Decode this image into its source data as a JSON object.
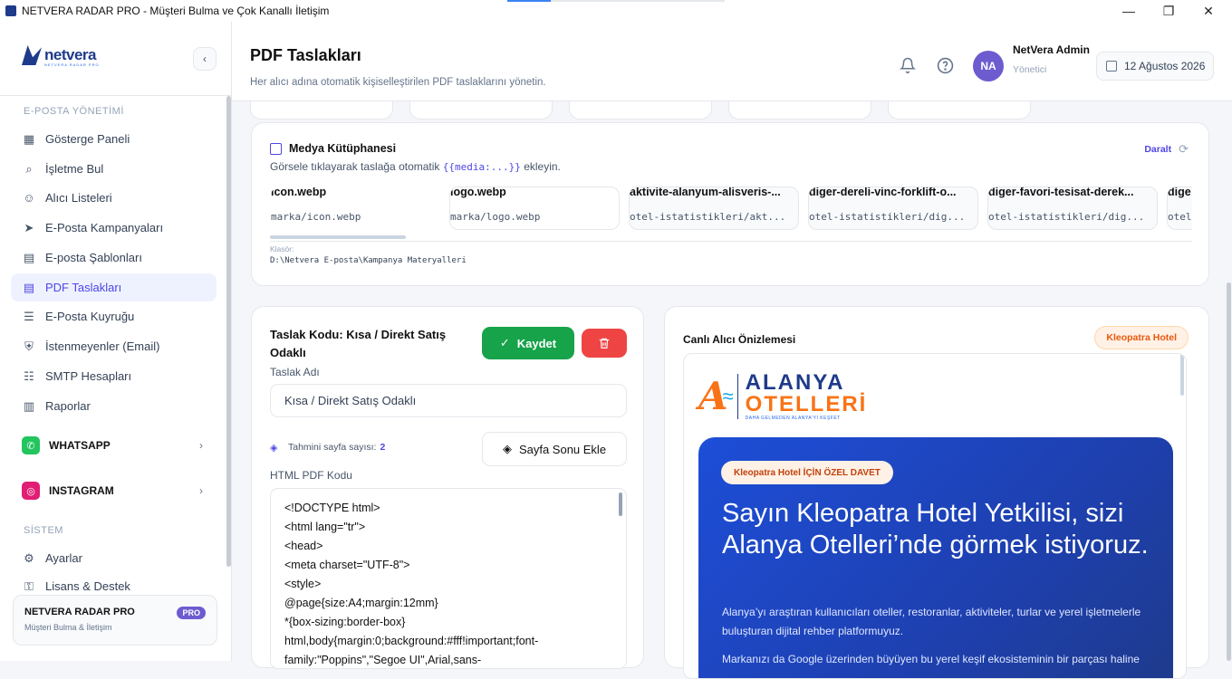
{
  "window": {
    "title": "NETVERA RADAR PRO - Müşteri Bulma ve Çok Kanallı İletişim",
    "minimize": "—",
    "maximize": "❐",
    "close": "✕"
  },
  "sidebar": {
    "section_email": "E-POSTA YÖNETİMİ",
    "items": [
      {
        "label": "Gösterge Paneli",
        "icon": "dashboard-icon"
      },
      {
        "label": "İşletme Bul",
        "icon": "search-icon"
      },
      {
        "label": "Alıcı Listeleri",
        "icon": "users-icon"
      },
      {
        "label": "E-Posta Kampanyaları",
        "icon": "send-icon"
      },
      {
        "label": "E-posta Şablonları",
        "icon": "file-icon"
      },
      {
        "label": "PDF Taslakları",
        "icon": "file-icon",
        "active": true
      },
      {
        "label": "E-Posta Kuyruğu",
        "icon": "list-icon"
      },
      {
        "label": "İstenmeyenler (Email)",
        "icon": "shield-icon"
      },
      {
        "label": "SMTP Hesapları",
        "icon": "server-icon"
      },
      {
        "label": "Raporlar",
        "icon": "chart-icon"
      }
    ],
    "whatsapp": "WHATSAPP",
    "instagram": "INSTAGRAM",
    "section_system": "SİSTEM",
    "settings": "Ayarlar",
    "license": "Lisans & Destek",
    "pro_title": "NETVERA RADAR PRO",
    "pro_sub": "Müşteri Bulma & İletişim",
    "pro_badge": "PRO"
  },
  "header": {
    "title": "PDF Taslakları",
    "subtitle": "Her alıcı adına otomatik kişiselleştirilen PDF taslaklarını yönetin.",
    "user_name": "NetVera Admin",
    "user_role": "Yönetici",
    "avatar": "NA",
    "date": "12 Ağustos 2026"
  },
  "media": {
    "title": "Medya Kütüphanesi",
    "desc_before": "Görsele tıklayarak taslağa otomatik ",
    "token": "{{media:...}}",
    "desc_after": " ekleyin.",
    "collapse": "Daralt",
    "tiles": [
      {
        "name": "icon.webp",
        "path": "marka/icon.webp"
      },
      {
        "name": "logo.webp",
        "path": "marka/logo.webp"
      },
      {
        "name": "aktivite-alanyum-alisveris-...",
        "path": "otel-istatistikleri/akt..."
      },
      {
        "name": "diger-dereli-vinc-forklift-o...",
        "path": "otel-istatistikleri/dig..."
      },
      {
        "name": "diger-favori-tesisat-derek...",
        "path": "otel-istatistikleri/dig..."
      },
      {
        "name": "dige",
        "path": "otel"
      }
    ],
    "folder_label": "Klasör:",
    "folder_path": "D:\\Netvera E-posta\\Kampanya Materyalleri"
  },
  "editor": {
    "heading": "Taslak Kodu: Kısa / Direkt Satış Odaklı",
    "save": "Kaydet",
    "name_label": "Taslak Adı",
    "name_value": "Kısa / Direkt Satış Odaklı",
    "pages_label": "Tahmini sayfa sayısı:",
    "pages_value": "2",
    "page_break": "Sayfa Sonu Ekle",
    "code_label": "HTML PDF Kodu",
    "code_lines": [
      "<!DOCTYPE html>",
      "<html lang=\"tr\">",
      "<head>",
      "<meta charset=\"UTF-8\">",
      "<style>",
      "@page{size:A4;margin:12mm}",
      "*{box-sizing:border-box}",
      "html,body{margin:0;background:#fff!important;font-",
      "family:\"Poppins\",\"Segoe UI\",Arial,sans-"
    ]
  },
  "preview": {
    "title": "Canlı Alıcı Önizlemesi",
    "recipient": "Kleopatra Hotel",
    "brand_line1": "ALANYA",
    "brand_line2": "OTELLERİ",
    "brand_tag": "DAHA GELMEDEN ALANYA'YI KEŞFET",
    "pill": "Kleopatra Hotel İÇİN ÖZEL DAVET",
    "headline": "Sayın Kleopatra Hotel Yetkilisi, sizi Alanya Otelleri’nde görmek istiyoruz.",
    "para1": "Alanya’yı araştıran kullanıcıları oteller, restoranlar, aktiviteler, turlar ve yerel işletmelerle buluşturan dijital rehber platformuyuz.",
    "para2": "Markanızı da Google üzerinden büyüyen bu yerel keşif ekosisteminin bir parçası haline"
  }
}
